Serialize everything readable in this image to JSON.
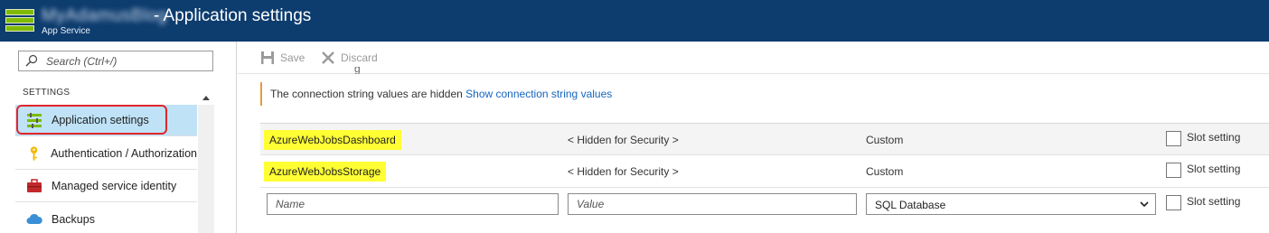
{
  "header": {
    "app_name": "MyAdamusBlog",
    "title": "- Application settings",
    "subtitle": "App Service",
    "background_color": "#0d3c6e"
  },
  "sidebar": {
    "search_placeholder": "Search (Ctrl+/)",
    "section_label": "SETTINGS",
    "items": [
      {
        "label": "Application settings",
        "icon": "app-settings-icon",
        "active": true
      },
      {
        "label": "Authentication / Authorization",
        "icon": "key-icon",
        "active": false
      },
      {
        "label": "Managed service identity",
        "icon": "toolbox-icon",
        "active": false
      },
      {
        "label": "Backups",
        "icon": "cloud-icon",
        "active": false
      }
    ],
    "highlight_color": "#e0262b"
  },
  "toolbar": {
    "save_label": "Save",
    "discard_label": "Discard"
  },
  "info": {
    "text": "The connection string values are hidden",
    "link": "Show connection string values",
    "partial_heading": "g"
  },
  "connection_strings": {
    "rows": [
      {
        "name": "AzureWebJobsDashboard",
        "value": "< Hidden for Security >",
        "type": "Custom",
        "slot_label": "Slot setting"
      },
      {
        "name": "AzureWebJobsStorage",
        "value": "< Hidden for Security >",
        "type": "Custom",
        "slot_label": "Slot setting"
      }
    ],
    "new_row": {
      "name_placeholder": "Name",
      "value_placeholder": "Value",
      "type_selected": "SQL Database",
      "slot_label": "Slot setting"
    }
  }
}
